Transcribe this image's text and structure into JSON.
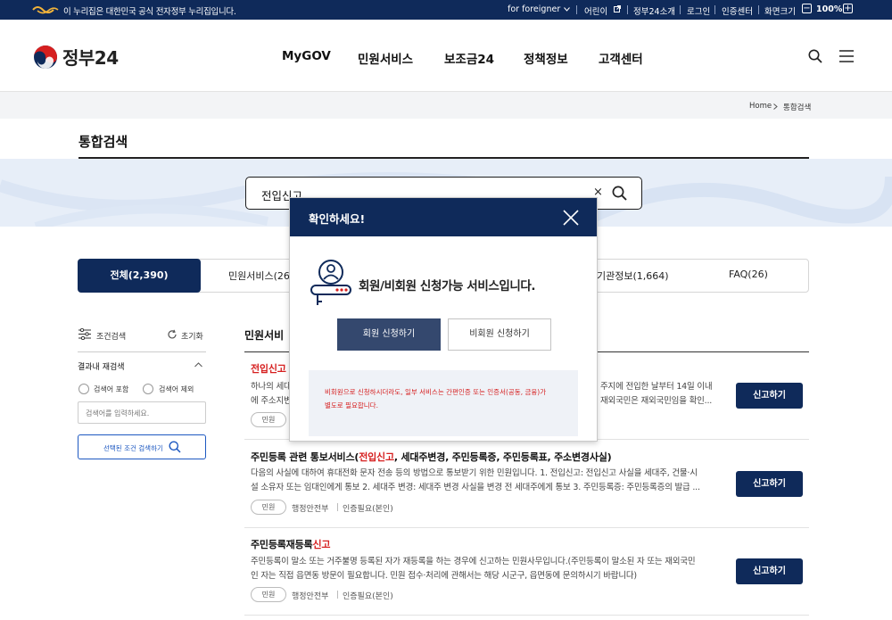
{
  "topbar": {
    "notice": "이 누리집은 대한민국 공식 전자정부 누리집입니다.",
    "foreigner": "for foreigner",
    "kids": "어린이",
    "about": "정부24소개",
    "login": "로그인",
    "cert": "인증센터",
    "fontsize": "화면크기",
    "zoom": "100%",
    "minus": "−",
    "plus": "+"
  },
  "header": {
    "brand": "정부24",
    "nav": [
      "MyGOV",
      "민원서비스",
      "보조금24",
      "정책정보",
      "고객센터"
    ]
  },
  "breadcrumb": {
    "home": "Home",
    "current": "통합검색"
  },
  "page": {
    "title": "통합검색"
  },
  "search": {
    "value": "전입신고",
    "clear": "×"
  },
  "tabs": [
    {
      "label": "전체(2,390)"
    },
    {
      "label": "민원서비스(26"
    },
    {
      "label": "기관정보(1,664)"
    },
    {
      "label": "FAQ(26)"
    }
  ],
  "sidebar": {
    "filter": "조건검색",
    "reset": "초기화",
    "section": "결과내 재검색",
    "include": "검색어 포함",
    "exclude": "검색어 제외",
    "placeholder": "검색어를 입력하세요.",
    "button": "선택된 조건 검색하기"
  },
  "results": {
    "heading": "민원서비",
    "items": [
      {
        "title_pre": "",
        "title_hl": "전입신고",
        "title_post": "",
        "desc1": "하나의 세대",
        "desc1b": "주지에 전입한 날부터 14일 이내",
        "desc2": "에 주소지변",
        "desc2b": "재외국민은 재외국민임을 확인...",
        "tag": "민원",
        "org": "",
        "auth": "",
        "button": "신고하기"
      },
      {
        "title_pre": "주민등록 관련 통보서비스(",
        "title_hl": "전입신고",
        "title_post": ", 세대주변경, 주민등록증, 주민등록표, 주소변경사실)",
        "desc1": "다음의 사실에 대하여 휴대전화 문자 전송 등의 방법으로 통보받기 위한 민원입니다. 1. 전입신고: 전입신고 사실을 세대주, 건물·시",
        "desc2": "설 소유자 또는 임대인에게 통보 2. 세대주 변경: 세대주 변경 사실을 변경 전 세대주에게 통보 3. 주민등록증: 주민등록증의 발급 ...",
        "tag": "민원",
        "org": "행정안전부",
        "auth": "인증필요(본인)",
        "button": "신고하기"
      },
      {
        "title_pre": "주민등록재등록",
        "title_hl": "신고",
        "title_post": "",
        "desc1": "주민등록이 말소 또는 거주불명 등록된 자가 재등록을 하는 경우에 신고하는 민원사무입니다.(주민등록이 말소된 자 또는 재외국민",
        "desc2": "인 자는 직접 읍면동 방문이 필요합니다. 민원 접수·처리에 관해서는 해당 시군구, 읍면동에 문의하시기 바랍니다)",
        "tag": "민원",
        "org": "행정안전부",
        "auth": "인증필요(본인)",
        "button": "신고하기"
      }
    ]
  },
  "modal": {
    "title": "확인하세요!",
    "message": "회원/비회원 신청가능 서비스입니다.",
    "member": "회원 신청하기",
    "guest": "비회원 신청하기",
    "note1": "비회원으로 신청하시더라도, 일부 서비스는 간편인증 또는 인증서(공동, 금융)가",
    "note2": "별도로 필요합니다."
  },
  "colors": {
    "navy": "#0f2a5a",
    "highlight": "#d61f1f",
    "accent": "#1d58c1"
  }
}
